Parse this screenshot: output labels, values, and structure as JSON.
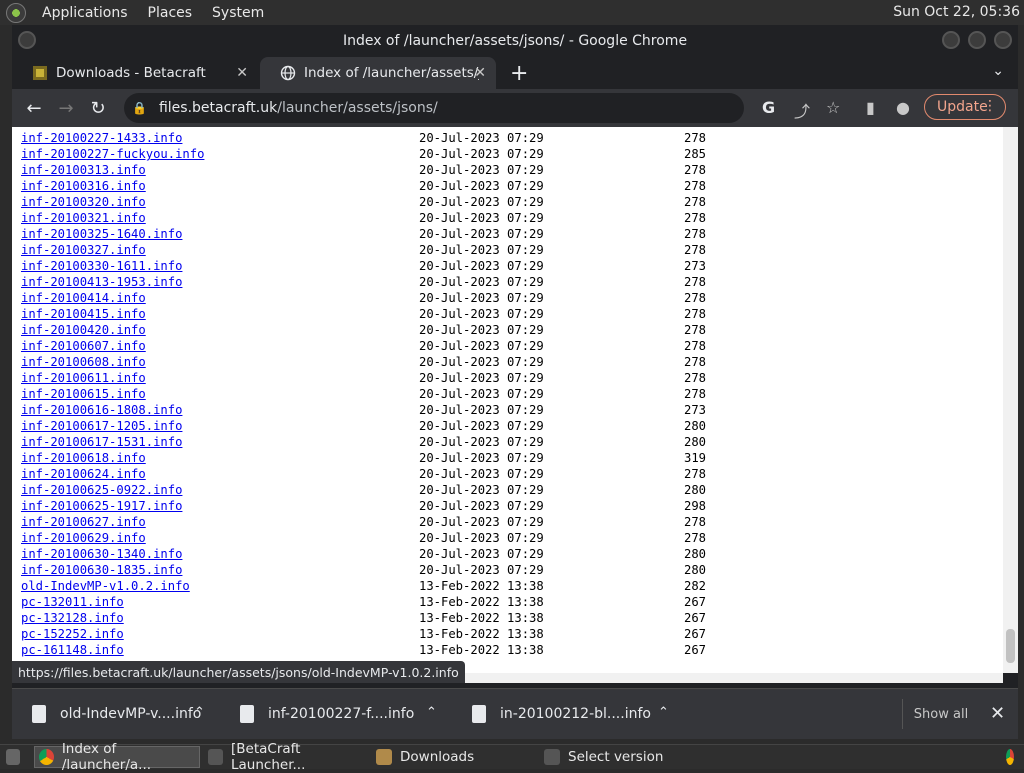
{
  "panel": {
    "menus": [
      "Applications",
      "Places",
      "System"
    ],
    "clock": "Sun Oct 22, 05:36"
  },
  "window": {
    "title": "Index of /launcher/assets/jsons/ - Google Chrome"
  },
  "tabs": [
    {
      "label": "Downloads - Betacraft",
      "active": false
    },
    {
      "label": "Index of /launcher/assets/jsons",
      "active": true
    }
  ],
  "toolbar": {
    "url_host": "files.betacraft.uk",
    "url_path": "/launcher/assets/jsons/",
    "update_label": "Update"
  },
  "listing": [
    {
      "name": "inf-20100227-1433.info",
      "date": "20-Jul-2023 07:29",
      "size": "278"
    },
    {
      "name": "inf-20100227-fuckyou.info",
      "date": "20-Jul-2023 07:29",
      "size": "285"
    },
    {
      "name": "inf-20100313.info",
      "date": "20-Jul-2023 07:29",
      "size": "278"
    },
    {
      "name": "inf-20100316.info",
      "date": "20-Jul-2023 07:29",
      "size": "278"
    },
    {
      "name": "inf-20100320.info",
      "date": "20-Jul-2023 07:29",
      "size": "278"
    },
    {
      "name": "inf-20100321.info",
      "date": "20-Jul-2023 07:29",
      "size": "278"
    },
    {
      "name": "inf-20100325-1640.info",
      "date": "20-Jul-2023 07:29",
      "size": "278"
    },
    {
      "name": "inf-20100327.info",
      "date": "20-Jul-2023 07:29",
      "size": "278"
    },
    {
      "name": "inf-20100330-1611.info",
      "date": "20-Jul-2023 07:29",
      "size": "273"
    },
    {
      "name": "inf-20100413-1953.info",
      "date": "20-Jul-2023 07:29",
      "size": "278"
    },
    {
      "name": "inf-20100414.info",
      "date": "20-Jul-2023 07:29",
      "size": "278"
    },
    {
      "name": "inf-20100415.info",
      "date": "20-Jul-2023 07:29",
      "size": "278"
    },
    {
      "name": "inf-20100420.info",
      "date": "20-Jul-2023 07:29",
      "size": "278"
    },
    {
      "name": "inf-20100607.info",
      "date": "20-Jul-2023 07:29",
      "size": "278"
    },
    {
      "name": "inf-20100608.info",
      "date": "20-Jul-2023 07:29",
      "size": "278"
    },
    {
      "name": "inf-20100611.info",
      "date": "20-Jul-2023 07:29",
      "size": "278"
    },
    {
      "name": "inf-20100615.info",
      "date": "20-Jul-2023 07:29",
      "size": "278"
    },
    {
      "name": "inf-20100616-1808.info",
      "date": "20-Jul-2023 07:29",
      "size": "273"
    },
    {
      "name": "inf-20100617-1205.info",
      "date": "20-Jul-2023 07:29",
      "size": "280"
    },
    {
      "name": "inf-20100617-1531.info",
      "date": "20-Jul-2023 07:29",
      "size": "280"
    },
    {
      "name": "inf-20100618.info",
      "date": "20-Jul-2023 07:29",
      "size": "319"
    },
    {
      "name": "inf-20100624.info",
      "date": "20-Jul-2023 07:29",
      "size": "278"
    },
    {
      "name": "inf-20100625-0922.info",
      "date": "20-Jul-2023 07:29",
      "size": "280"
    },
    {
      "name": "inf-20100625-1917.info",
      "date": "20-Jul-2023 07:29",
      "size": "298"
    },
    {
      "name": "inf-20100627.info",
      "date": "20-Jul-2023 07:29",
      "size": "278"
    },
    {
      "name": "inf-20100629.info",
      "date": "20-Jul-2023 07:29",
      "size": "278"
    },
    {
      "name": "inf-20100630-1340.info",
      "date": "20-Jul-2023 07:29",
      "size": "280"
    },
    {
      "name": "inf-20100630-1835.info",
      "date": "20-Jul-2023 07:29",
      "size": "280"
    },
    {
      "name": "old-IndevMP-v1.0.2.info",
      "date": "13-Feb-2022 13:38",
      "size": "282"
    },
    {
      "name": "pc-132011.info",
      "date": "13-Feb-2022 13:38",
      "size": "267"
    },
    {
      "name": "pc-132128.info",
      "date": "13-Feb-2022 13:38",
      "size": "267"
    },
    {
      "name": "pc-152252.info",
      "date": "13-Feb-2022 13:38",
      "size": "267"
    },
    {
      "name": "pc-161148.info",
      "date": "13-Feb-2022 13:38",
      "size": "267"
    }
  ],
  "status_url": "https://files.betacraft.uk/launcher/assets/jsons/old-IndevMP-v1.0.2.info",
  "downloads": [
    {
      "name": "old-IndevMP-v....info"
    },
    {
      "name": "inf-20100227-f....info"
    },
    {
      "name": "in-20100212-bl....info"
    }
  ],
  "show_all_label": "Show all",
  "taskbar": [
    {
      "label": "Index of /launcher/a...",
      "active": true
    },
    {
      "label": "[BetaCraft Launcher...",
      "active": false
    },
    {
      "label": "Downloads",
      "active": false
    },
    {
      "label": "Select version",
      "active": false
    }
  ]
}
